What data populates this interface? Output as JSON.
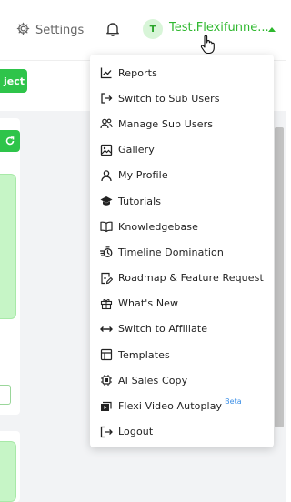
{
  "header": {
    "settings_label": "Settings",
    "avatar_initial": "T",
    "username": "Test.Flexifunne...",
    "colors": {
      "accent": "#2eb82e",
      "button": "#2ec44a"
    }
  },
  "page": {
    "project_button_label": "ject"
  },
  "menu": {
    "items": [
      {
        "label": "Reports",
        "icon": "chart-line-icon"
      },
      {
        "label": "Switch to Sub Users",
        "icon": "switch-user-icon"
      },
      {
        "label": "Manage Sub Users",
        "icon": "users-icon"
      },
      {
        "label": "Gallery",
        "icon": "image-icon"
      },
      {
        "label": "My Profile",
        "icon": "user-icon"
      },
      {
        "label": "Tutorials",
        "icon": "graduation-cap-icon"
      },
      {
        "label": "Knowledgebase",
        "icon": "book-open-icon"
      },
      {
        "label": "Timeline Domination",
        "icon": "timer-icon"
      },
      {
        "label": "Roadmap & Feature Request",
        "icon": "roadmap-edit-icon"
      },
      {
        "label": "What's New",
        "icon": "gift-icon"
      },
      {
        "label": "Switch to Affiliate",
        "icon": "arrows-horizontal-icon"
      },
      {
        "label": "Templates",
        "icon": "template-icon"
      },
      {
        "label": "AI Sales Copy",
        "icon": "ai-chip-icon"
      },
      {
        "label": "Flexi Video Autoplay",
        "icon": "video-icon",
        "badge": "Beta"
      },
      {
        "label": "Logout",
        "icon": "logout-icon"
      }
    ]
  }
}
